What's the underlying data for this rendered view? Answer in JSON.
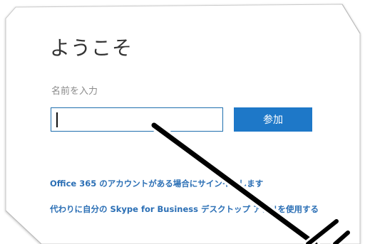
{
  "welcome": {
    "title": "ようこそ",
    "name_label": "名前を入力",
    "name_value": "",
    "join_label": "参加",
    "office_link": "Office 365 のアカウントがある場合にサインインします",
    "skype_link": "代わりに自分の Skype for Business デスクトップ アプリを使用する"
  },
  "colors": {
    "accent": "#1e78c8",
    "link": "#2b6fb5",
    "input_border": "#1f6fae",
    "title": "#333333",
    "label": "#8a8a8a"
  }
}
